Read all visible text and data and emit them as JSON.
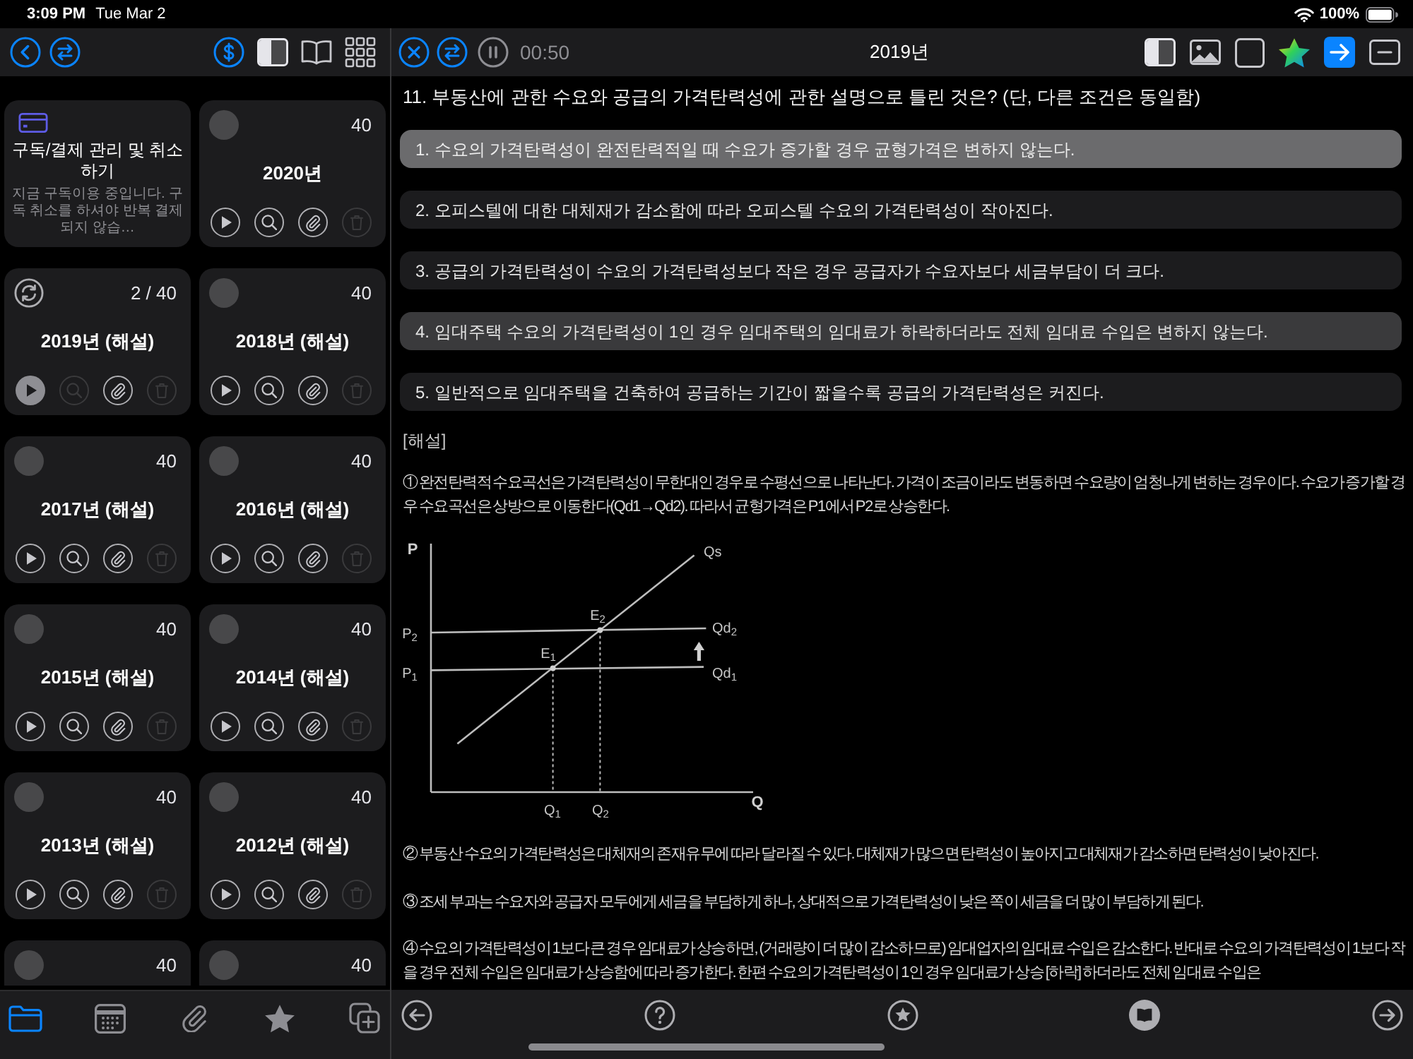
{
  "status_bar": {
    "time": "3:09 PM",
    "date": "Tue Mar 2",
    "battery": "100%"
  },
  "sidebar": {
    "subscription_card": {
      "title": "구독/결제 관리 및 취소 하기",
      "description": "지금 구독이용 중입니다. 구독 취소를 하셔야 반복 결제되지 않습…"
    },
    "cards": [
      {
        "kind": "exam",
        "title": "2020년",
        "count": "40",
        "in_progress": false,
        "search_disabled": false,
        "delete_disabled": true
      },
      {
        "kind": "exam",
        "title": "2019년 (해설)",
        "count": "2 / 40",
        "in_progress": true,
        "search_disabled": true,
        "delete_disabled": true
      },
      {
        "kind": "exam",
        "title": "2018년 (해설)",
        "count": "40",
        "in_progress": false,
        "search_disabled": false,
        "delete_disabled": true
      },
      {
        "kind": "exam",
        "title": "2017년 (해설)",
        "count": "40",
        "in_progress": false,
        "search_disabled": false,
        "delete_disabled": true
      },
      {
        "kind": "exam",
        "title": "2016년 (해설)",
        "count": "40",
        "in_progress": false,
        "search_disabled": false,
        "delete_disabled": true
      },
      {
        "kind": "exam",
        "title": "2015년 (해설)",
        "count": "40",
        "in_progress": false,
        "search_disabled": false,
        "delete_disabled": true
      },
      {
        "kind": "exam",
        "title": "2014년 (해설)",
        "count": "40",
        "in_progress": false,
        "search_disabled": false,
        "delete_disabled": true
      },
      {
        "kind": "exam",
        "title": "2013년 (해설)",
        "count": "40",
        "in_progress": false,
        "search_disabled": false,
        "delete_disabled": true
      },
      {
        "kind": "exam",
        "title": "2012년 (해설)",
        "count": "40",
        "in_progress": false,
        "search_disabled": false,
        "delete_disabled": true
      },
      {
        "kind": "exam_partial",
        "count": "40",
        "in_progress": false
      },
      {
        "kind": "exam_partial",
        "count": "40",
        "in_progress": false
      }
    ],
    "tab_bar": [
      {
        "selected": true
      },
      {
        "selected": false
      },
      {
        "selected": false
      },
      {
        "selected": false
      },
      {
        "selected": false
      }
    ]
  },
  "quiz": {
    "toolbar": {
      "timer": "00:50",
      "title": "2019년",
      "arrow_toggle_on": true
    },
    "question": "11. 부동산에 관한 수요와 공급의 가격탄력성에 관한 설명으로 틀린 것은? (단, 다른 조건은 동일함)",
    "options": [
      {
        "text": "1. 수요의 가격탄력성이 완전탄력적일 때 수요가 증가할 경우 균형가격은 변하지 않는다.",
        "answer": true,
        "selected": false
      },
      {
        "text": "2. 오피스텔에 대한 대체재가 감소함에 따라 오피스텔 수요의 가격탄력성이 작아진다.",
        "answer": false,
        "selected": false
      },
      {
        "text": "3. 공급의 가격탄력성이 수요의 가격탄력성보다 작은 경우 공급자가 수요자보다 세금부담이 더 크다.",
        "answer": false,
        "selected": false
      },
      {
        "text": "4. 임대주택 수요의 가격탄력성이 1인 경우 임대주택의 임대료가 하락하더라도 전체 임대료 수입은 변하지 않는다.",
        "answer": false,
        "selected": true
      },
      {
        "text": "5. 일반적으로 임대주택을 건축하여 공급하는 기간이 짧을수록 공급의 가격탄력성은 커진다.",
        "answer": false,
        "selected": false
      }
    ],
    "explanation_heading": "[해설]",
    "explanation": [
      {
        "kind": "text",
        "text": "① 완전탄력적 수요곡선은 가격탄력성이 무한대인 경우로 수평선으로 나타난다. 가격이 조금이라도 변동하면 수요량이 엄청나게 변하는 경우이다. 수요가 증가할 경우 수요곡선은 상방으로 이동한다(Qd1→Qd2). 따라서 균형가격은 P1에서 P2로 상승한다."
      },
      {
        "kind": "figure",
        "price_axis": "P",
        "quantity_axis": "Q",
        "supply_label": "Qs",
        "demand_labels": [
          "Qd$_{2}$",
          "Qd$_{1}$"
        ],
        "price_labels": [
          "P$_{2}$",
          "P$_{1}$"
        ],
        "point_labels": [
          "E$_{1}$",
          "E$_{2}$"
        ],
        "quantity_labels": [
          "Q$_{1}$",
          "Q$_{2}$"
        ]
      },
      {
        "kind": "text",
        "text": "② 부동산 수요의 가격탄력성은 대체재의 존재유무에 따라 달라질 수 있다. 대체재가 많으면 탄력성이 높아지고 대체재가 감소하면 탄력성이 낮아진다."
      },
      {
        "kind": "text",
        "text": "③ 조세 부과는 수요자와 공급자 모두에게 세금을 부담하게 하나, 상대적으로 가격탄력성이 낮은 쪽이 세금을 더 많이 부담하게 된다."
      },
      {
        "kind": "text",
        "text": "④ 수요의 가격탄력성이 1보다 큰 경우 임대료가 상승하면, (거래량이 더 많이 감소하므로) 임대업자의 임대료 수입은 감소한다. 반대로 수요의 가격탄력성이 1보다 작을 경우 전체 수입은 임대료가 상승함에 따라 증가한다. 한편 수요의 가격탄력성이 1인 경우 임대료가 상승 [하락] 하더라도 전체 임대료 수입은"
      }
    ]
  }
}
